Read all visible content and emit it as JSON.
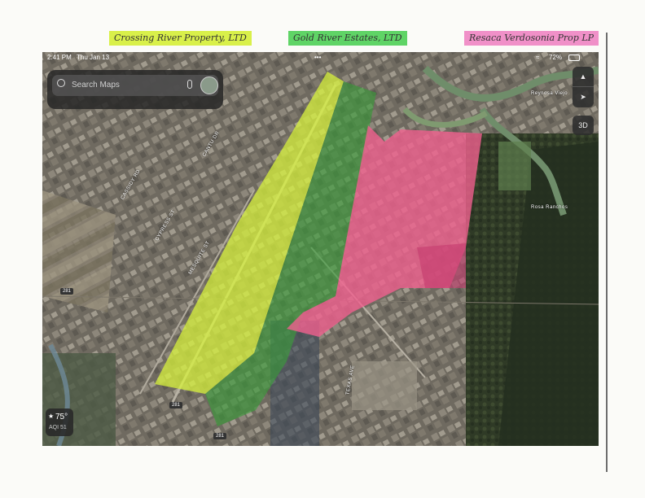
{
  "annotations": [
    {
      "text": "Crossing River Property, LTD",
      "color": "#d9f04a"
    },
    {
      "text": "Gold River Estates, LTD",
      "color": "#5fd466"
    },
    {
      "text": "Resaca Verdosonia Prop LP",
      "color": "#f090c8"
    }
  ],
  "status_bar": {
    "time": "2:41 PM",
    "date": "Thu Jan 13",
    "battery": "72%",
    "dots": "•••"
  },
  "search": {
    "placeholder": "Search Maps"
  },
  "map_controls": {
    "compass_icon": "compass-icon",
    "location_icon": "location-arrow-icon",
    "mode": "3D"
  },
  "map_labels": {
    "lake": "Rosa Ranchos",
    "place": "Reynosa Viejo",
    "highway_1": "281",
    "highway_2": "281",
    "highway_3": "281",
    "road_1": "CASSIDY RD",
    "road_2": "CYPRESS ST",
    "road_3": "MESQUITE ST",
    "road_4": "CANTU DR",
    "road_5": "TEXAS AVE"
  },
  "weather": {
    "icon": "star-icon",
    "temperature": "75°",
    "aqi": "AQI 51"
  },
  "overlay_colors": {
    "crossing_river": "#d7f23c",
    "gold_river": "#3a9a3a",
    "resaca": "#f0608e"
  }
}
